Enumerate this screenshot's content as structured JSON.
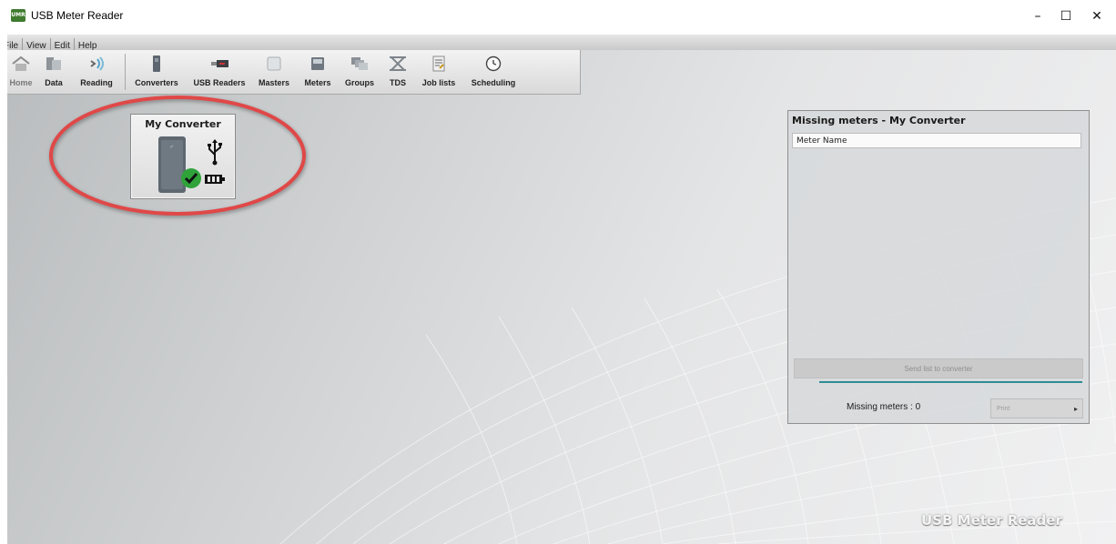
{
  "window": {
    "title": "USB Meter Reader",
    "minimize_symbol": "–",
    "maximize_symbol": "☐",
    "close_symbol": "✕"
  },
  "menu": [
    "File",
    "View",
    "Edit",
    "Help"
  ],
  "toolbar": {
    "home": "Home",
    "data": "Data",
    "reading": "Reading",
    "converters": "Converters",
    "usb_readers": "USB Readers",
    "masters": "Masters",
    "meters": "Meters",
    "groups": "Groups",
    "tds": "TDS",
    "job_lists": "Job lists",
    "scheduling": "Scheduling"
  },
  "converter_card": {
    "name": "My Converter",
    "usb_symbol": "Ψ",
    "status_icon": "check-icon",
    "status_color": "#2fa33a",
    "highlighted": true,
    "highlight_color": "#e04848"
  },
  "missing_panel": {
    "title": "Missing meters - My Converter",
    "column_header": "Meter Name",
    "send_button": "Send list to converter",
    "progress": 1.0,
    "missing_label": "Missing meters : 0",
    "print_button": "Print",
    "print_arrow": "▸"
  },
  "brand": "USB Meter Reader",
  "colors": {
    "accent_progress": "#2f8d92",
    "app_icon": "#3f7a2e"
  }
}
